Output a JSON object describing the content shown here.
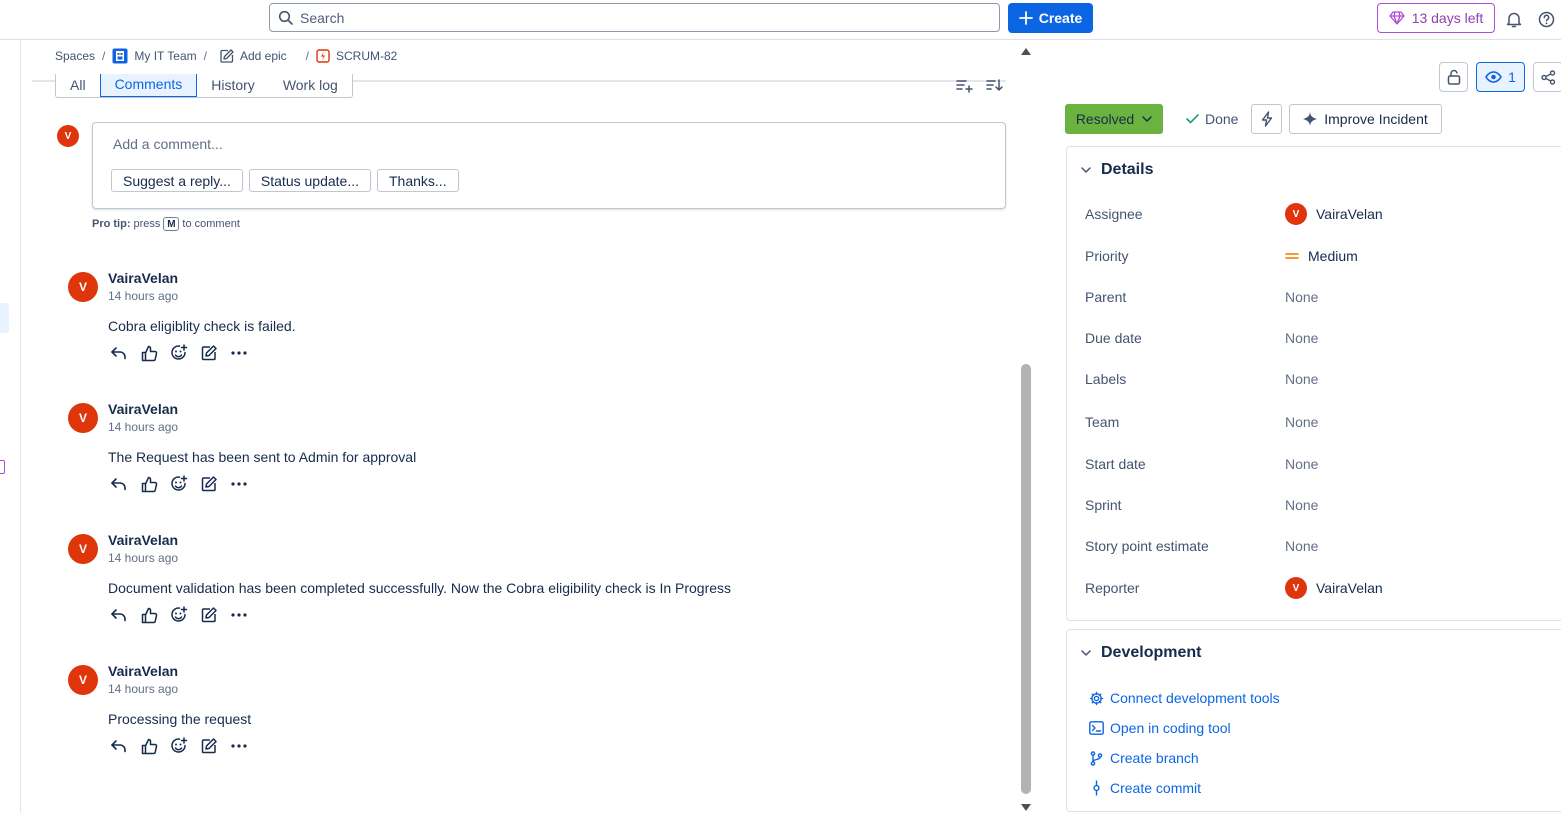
{
  "topbar": {
    "search_placeholder": "Search",
    "create_label": "Create",
    "trial_label": "13 days left"
  },
  "breadcrumb": {
    "spaces": "Spaces",
    "project": "My IT Team",
    "epic": "Add epic",
    "issue_key": "SCRUM-82"
  },
  "tabs": [
    {
      "label": "All"
    },
    {
      "label": "Comments"
    },
    {
      "label": "History"
    },
    {
      "label": "Work log"
    }
  ],
  "composer": {
    "avatar_initial": "V",
    "placeholder": "Add a comment...",
    "quick_replies": [
      "Suggest a reply...",
      "Status update...",
      "Thanks..."
    ],
    "pro_tip_bold": "Pro tip:",
    "pro_tip_pre": "press",
    "pro_tip_key": "M",
    "pro_tip_post": "to comment"
  },
  "comments": [
    {
      "initial": "V",
      "author": "VairaVelan",
      "time": "14 hours ago",
      "body": "Cobra eligiblity check is failed."
    },
    {
      "initial": "V",
      "author": "VairaVelan",
      "time": "14 hours ago",
      "body": "The Request has been sent to Admin for approval"
    },
    {
      "initial": "V",
      "author": "VairaVelan",
      "time": "14 hours ago",
      "body": "Document validation has been completed successfully. Now the Cobra eligibility check is In Progress"
    },
    {
      "initial": "V",
      "author": "VairaVelan",
      "time": "14 hours ago",
      "body": "Processing the request"
    }
  ],
  "issue_actions": {
    "watch_count": "1",
    "status": "Resolved",
    "resolution": "Done",
    "improve_label": "Improve Incident"
  },
  "details": {
    "title": "Details",
    "fields": [
      {
        "label": "Assignee",
        "value": "VairaVelan",
        "avatar": "V"
      },
      {
        "label": "Priority",
        "value": "Medium"
      },
      {
        "label": "Parent",
        "value": "None"
      },
      {
        "label": "Due date",
        "value": "None"
      },
      {
        "label": "Labels",
        "value": "None"
      },
      {
        "label": "Team",
        "value": "None"
      },
      {
        "label": "Start date",
        "value": "None"
      },
      {
        "label": "Sprint",
        "value": "None"
      },
      {
        "label": "Story point estimate",
        "value": "None"
      },
      {
        "label": "Reporter",
        "value": "VairaVelan",
        "avatar": "V"
      }
    ]
  },
  "development": {
    "title": "Development",
    "links": [
      "Connect development tools",
      "Open in coding tool",
      "Create branch",
      "Create commit"
    ]
  },
  "colors": {
    "brand_blue": "#0c66e4",
    "avatar_red": "#de350b",
    "resolved_green": "#6bb33f",
    "trial_purple": "#ae4ed6",
    "priority_orange": "#f18d13"
  }
}
